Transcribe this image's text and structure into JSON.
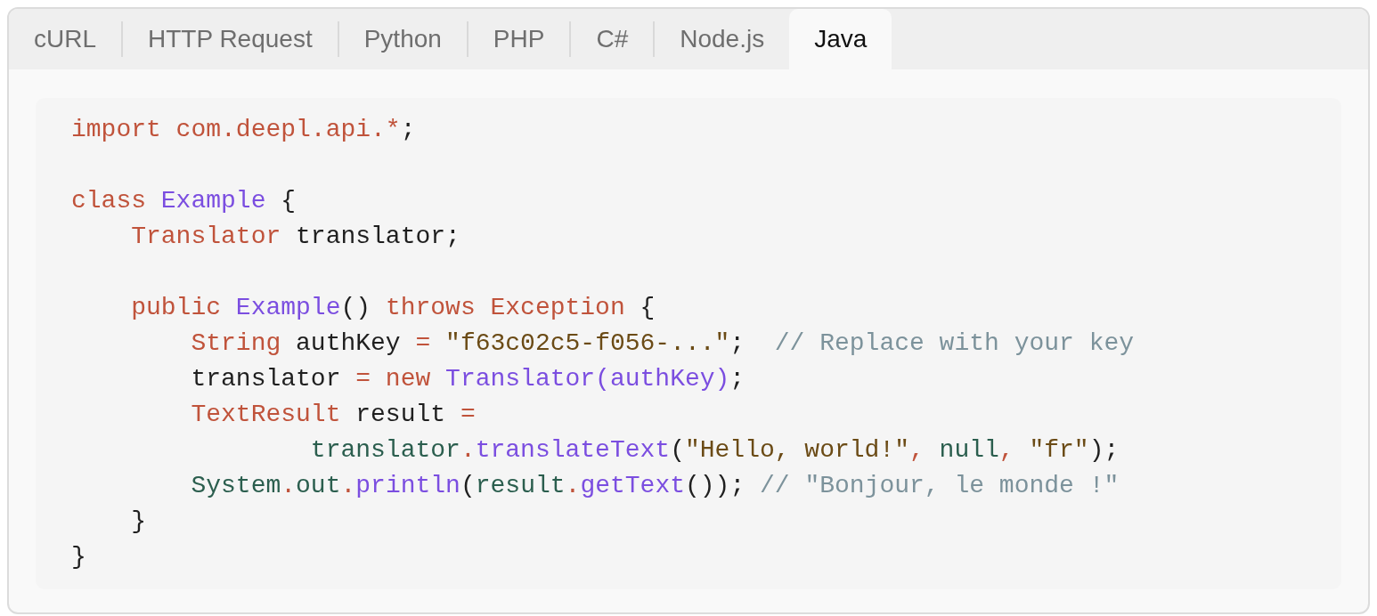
{
  "tabs": [
    {
      "label": "cURL",
      "selected": false
    },
    {
      "label": "HTTP Request",
      "selected": false
    },
    {
      "label": "Python",
      "selected": false
    },
    {
      "label": "PHP",
      "selected": false
    },
    {
      "label": "C#",
      "selected": false
    },
    {
      "label": "Node.js",
      "selected": false
    },
    {
      "label": "Java",
      "selected": true
    }
  ],
  "code_lines": [
    {
      "kind": "code",
      "tokens": [
        {
          "kind": "keyword",
          "text": "import com.deepl.api.*"
        },
        {
          "kind": "plain",
          "text": ";"
        }
      ]
    },
    {
      "kind": "blank"
    },
    {
      "kind": "code",
      "tokens": [
        {
          "kind": "keyword",
          "text": "class"
        },
        {
          "kind": "title",
          "text": " Example"
        },
        {
          "kind": "plain",
          "text": " {"
        }
      ]
    },
    {
      "kind": "code",
      "tokens": [
        {
          "kind": "keyword",
          "text": "    Translator"
        },
        {
          "kind": "plain",
          "text": " translator;"
        }
      ]
    },
    {
      "kind": "blank"
    },
    {
      "kind": "code",
      "tokens": [
        {
          "kind": "keyword",
          "text": "    public"
        },
        {
          "kind": "title",
          "text": " Example"
        },
        {
          "kind": "plain",
          "text": "() "
        },
        {
          "kind": "keyword",
          "text": "throws Exception"
        },
        {
          "kind": "plain",
          "text": " {"
        }
      ]
    },
    {
      "kind": "code",
      "tokens": [
        {
          "kind": "keyword",
          "text": "        String"
        },
        {
          "kind": "plain",
          "text": " authKey "
        },
        {
          "kind": "keyword",
          "text": "="
        },
        {
          "kind": "string",
          "text": " \"f63c02c5-f056-...\""
        },
        {
          "kind": "plain",
          "text": ";  "
        },
        {
          "kind": "comment",
          "text": "// Replace with your key"
        }
      ]
    },
    {
      "kind": "code",
      "tokens": [
        {
          "kind": "plain",
          "text": "        translator "
        },
        {
          "kind": "keyword",
          "text": "= new"
        },
        {
          "kind": "title",
          "text": " Translator(authKey)"
        },
        {
          "kind": "plain",
          "text": ";"
        }
      ]
    },
    {
      "kind": "code",
      "tokens": [
        {
          "kind": "keyword",
          "text": "        TextResult"
        },
        {
          "kind": "plain",
          "text": " result "
        },
        {
          "kind": "keyword",
          "text": "="
        }
      ]
    },
    {
      "kind": "code",
      "tokens": [
        {
          "kind": "variable",
          "text": "                translator"
        },
        {
          "kind": "keyword",
          "text": "."
        },
        {
          "kind": "title",
          "text": "translateText"
        },
        {
          "kind": "plain",
          "text": "("
        },
        {
          "kind": "string",
          "text": "\"Hello, world!\""
        },
        {
          "kind": "keyword",
          "text": ","
        },
        {
          "kind": "variable",
          "text": " null"
        },
        {
          "kind": "keyword",
          "text": ","
        },
        {
          "kind": "string",
          "text": " \"fr\""
        },
        {
          "kind": "plain",
          "text": ");"
        }
      ]
    },
    {
      "kind": "code",
      "tokens": [
        {
          "kind": "variable",
          "text": "        System"
        },
        {
          "kind": "keyword",
          "text": "."
        },
        {
          "kind": "variable",
          "text": "out"
        },
        {
          "kind": "keyword",
          "text": "."
        },
        {
          "kind": "title",
          "text": "println"
        },
        {
          "kind": "plain",
          "text": "("
        },
        {
          "kind": "variable",
          "text": "result"
        },
        {
          "kind": "keyword",
          "text": "."
        },
        {
          "kind": "title",
          "text": "getText"
        },
        {
          "kind": "plain",
          "text": "()); "
        },
        {
          "kind": "comment",
          "text": "// \"Bonjour, le monde !\""
        }
      ]
    },
    {
      "kind": "code",
      "tokens": [
        {
          "kind": "plain",
          "text": "    }"
        }
      ]
    },
    {
      "kind": "code",
      "tokens": [
        {
          "kind": "plain",
          "text": "}"
        }
      ]
    }
  ]
}
